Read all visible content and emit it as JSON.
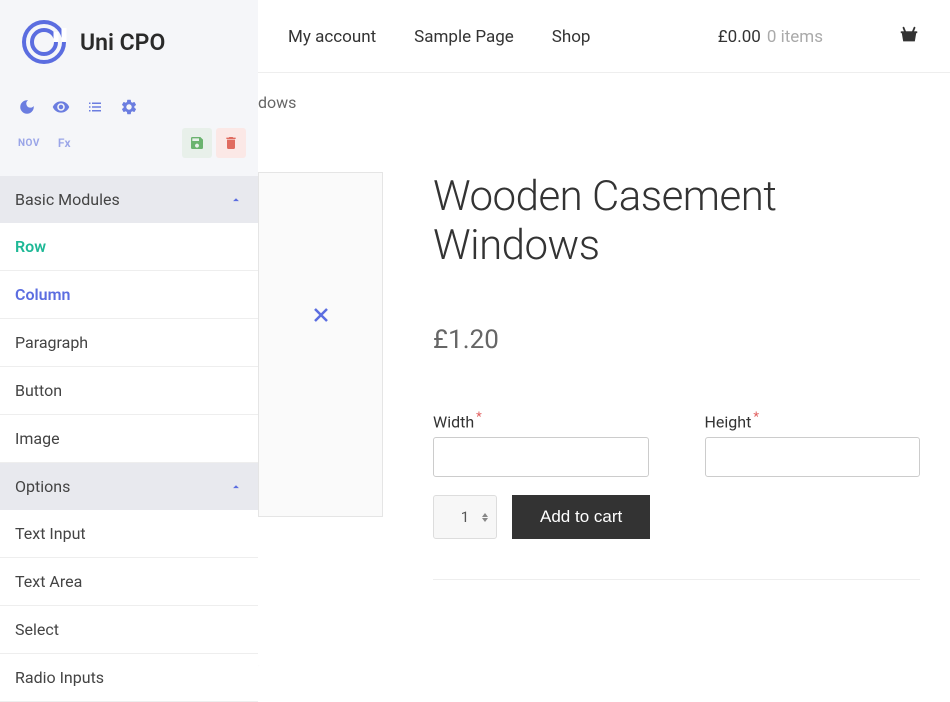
{
  "logo": {
    "text": "Uni CPO"
  },
  "toolbar": {
    "nov_badge": "NOV",
    "fx_badge": "Fx"
  },
  "sections": {
    "basic": {
      "title": "Basic Modules",
      "items": [
        "Row",
        "Column",
        "Paragraph",
        "Button",
        "Image"
      ]
    },
    "options": {
      "title": "Options",
      "items": [
        "Text Input",
        "Text Area",
        "Select",
        "Radio Inputs"
      ]
    }
  },
  "nav": {
    "account": "My account",
    "sample": "Sample Page",
    "shop": "Shop"
  },
  "cart_summary": {
    "price": "£0.00",
    "items": "0 items"
  },
  "breadcrumb_tail": "dows",
  "product": {
    "title": "Wooden Casement Windows",
    "price": "£1.20",
    "width_label": "Width",
    "height_label": "Height",
    "qty": "1",
    "add_to_cart": "Add to cart"
  }
}
